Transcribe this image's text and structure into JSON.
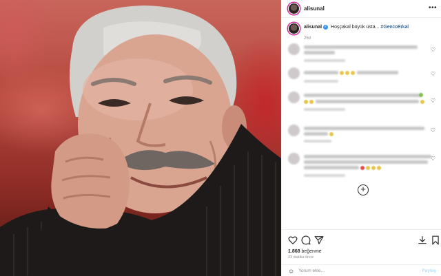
{
  "post": {
    "username": "alisunal",
    "verified_mark": "✓",
    "more_icon": "•••",
    "caption_text": "Hoşçakal büyük usta...",
    "caption_hashtag": "#GencoErkal",
    "caption_age": "25d"
  },
  "comments": {
    "like_icon": "♡",
    "load_more_icon": "+"
  },
  "footer": {
    "likes_count": "1.868",
    "likes_label": "beğenme",
    "time_ago": "23 dakika önce",
    "emoji_icon": "☺",
    "comment_placeholder": "Yorum ekle...",
    "post_label": "Paylaş"
  },
  "colors": {
    "accent": "#3897f0",
    "hashtag": "#00376b",
    "story_ring": "#d6249f"
  }
}
